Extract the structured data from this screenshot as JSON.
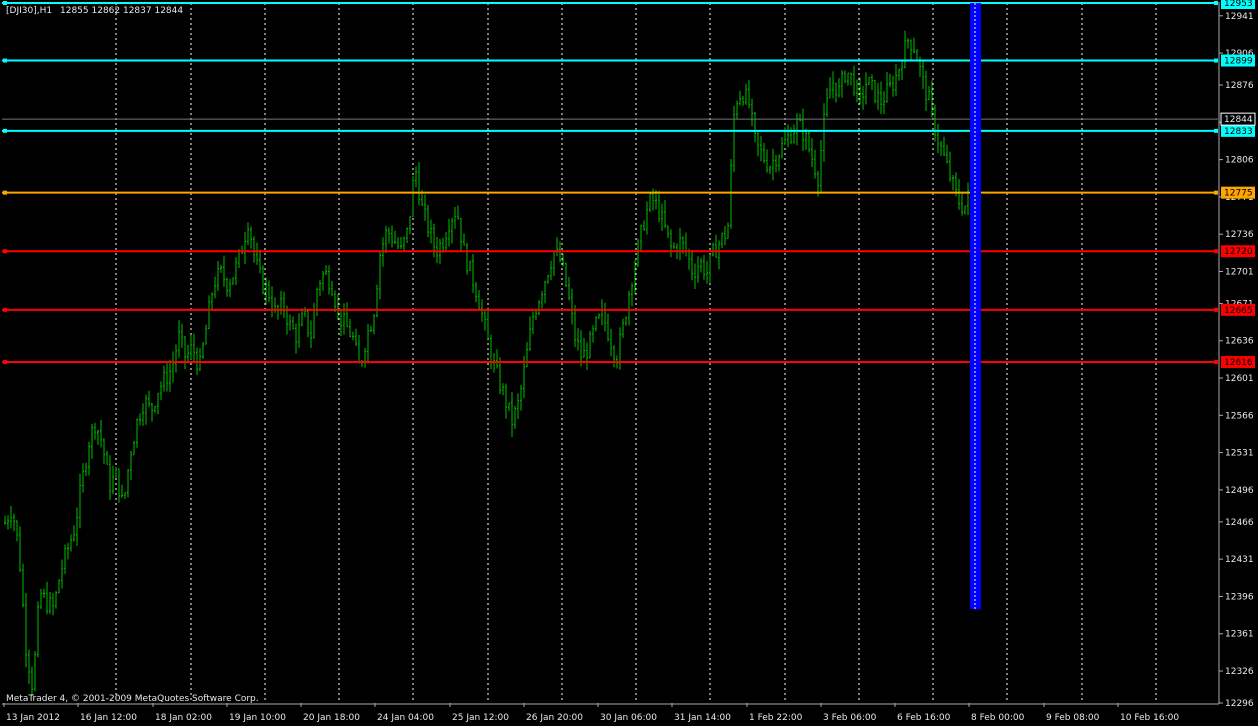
{
  "header": {
    "symbol_timeframe": "[DJI30],H1",
    "ohlc": "12855 12862 12837 12844"
  },
  "copyright": "MetaTrader 4, © 2001-2009 MetaQuotes Software Corp.",
  "chart_data": {
    "type": "bar",
    "symbol": "[DJI30]",
    "timeframe": "H1",
    "last_ohlc": {
      "open": 12855,
      "high": 12862,
      "low": 12837,
      "close": 12844
    },
    "ylim": [
      12296,
      12953
    ],
    "y_ticks": [
      12941,
      12906,
      12876,
      12841,
      12806,
      12771,
      12736,
      12701,
      12671,
      12636,
      12601,
      12566,
      12531,
      12496,
      12466,
      12431,
      12396,
      12361,
      12326,
      12296
    ],
    "x_ticks": [
      "13 Jan 2012",
      "16 Jan 12:00",
      "18 Jan 02:00",
      "19 Jan 10:00",
      "20 Jan 18:00",
      "24 Jan 04:00",
      "25 Jan 12:00",
      "26 Jan 20:00",
      "30 Jan 06:00",
      "31 Jan 14:00",
      "1 Feb 22:00",
      "3 Feb 06:00",
      "6 Feb 16:00",
      "8 Feb 00:00",
      "9 Feb 08:00",
      "10 Feb 16:00"
    ],
    "grid": true,
    "current_price": 12844,
    "price_levels": [
      {
        "value": 12953,
        "label": "12953",
        "color": "#00FFFF"
      },
      {
        "value": 12899,
        "label": "12899",
        "color": "#00FFFF"
      },
      {
        "value": 12833,
        "label": "12833",
        "color": "#00FFFF"
      },
      {
        "value": 12775,
        "label": "12775",
        "color": "#FFA500"
      },
      {
        "value": 12720,
        "label": "12720",
        "color": "#FF0000"
      },
      {
        "value": 12665,
        "label": "12665",
        "color": "#FF0000"
      },
      {
        "value": 12616,
        "label": "12616",
        "color": "#FF0000"
      }
    ],
    "bar_color": "#00C000",
    "highlight_color": "#0000FF",
    "close_path": [
      12465,
      12480,
      12440,
      12350,
      12310,
      12400,
      12390,
      12385,
      12420,
      12440,
      12460,
      12500,
      12540,
      12560,
      12540,
      12500,
      12510,
      12480,
      12530,
      12560,
      12580,
      12570,
      12590,
      12600,
      12610,
      12640,
      12620,
      12630,
      12610,
      12650,
      12690,
      12700,
      12690,
      12700,
      12720,
      12750,
      12710,
      12690,
      12680,
      12660,
      12670,
      12650,
      12640,
      12660,
      12640,
      12690,
      12700,
      12690,
      12660,
      12650,
      12640,
      12610,
      12640,
      12660,
      12720,
      12740,
      12730,
      12720,
      12740,
      12800,
      12760,
      12740,
      12720,
      12730,
      12750,
      12760,
      12720,
      12700,
      12680,
      12650,
      12620,
      12600,
      12580,
      12560,
      12580,
      12620,
      12660,
      12680,
      12700,
      12720,
      12710,
      12680,
      12640,
      12620,
      12630,
      12650,
      12660,
      12640,
      12620,
      12650,
      12690,
      12720,
      12750,
      12770,
      12760,
      12740,
      12720,
      12730,
      12720,
      12700,
      12710,
      12700,
      12720,
      12730,
      12740,
      12860,
      12870,
      12860,
      12820,
      12810,
      12800,
      12810,
      12820,
      12830,
      12840,
      12830,
      12810,
      12790,
      12850,
      12880,
      12870,
      12890,
      12880,
      12860,
      12880,
      12870,
      12860,
      12870,
      12880,
      12900,
      12920,
      12910,
      12880,
      12860,
      12830,
      12810,
      12790,
      12770,
      12760,
      12780
    ]
  }
}
